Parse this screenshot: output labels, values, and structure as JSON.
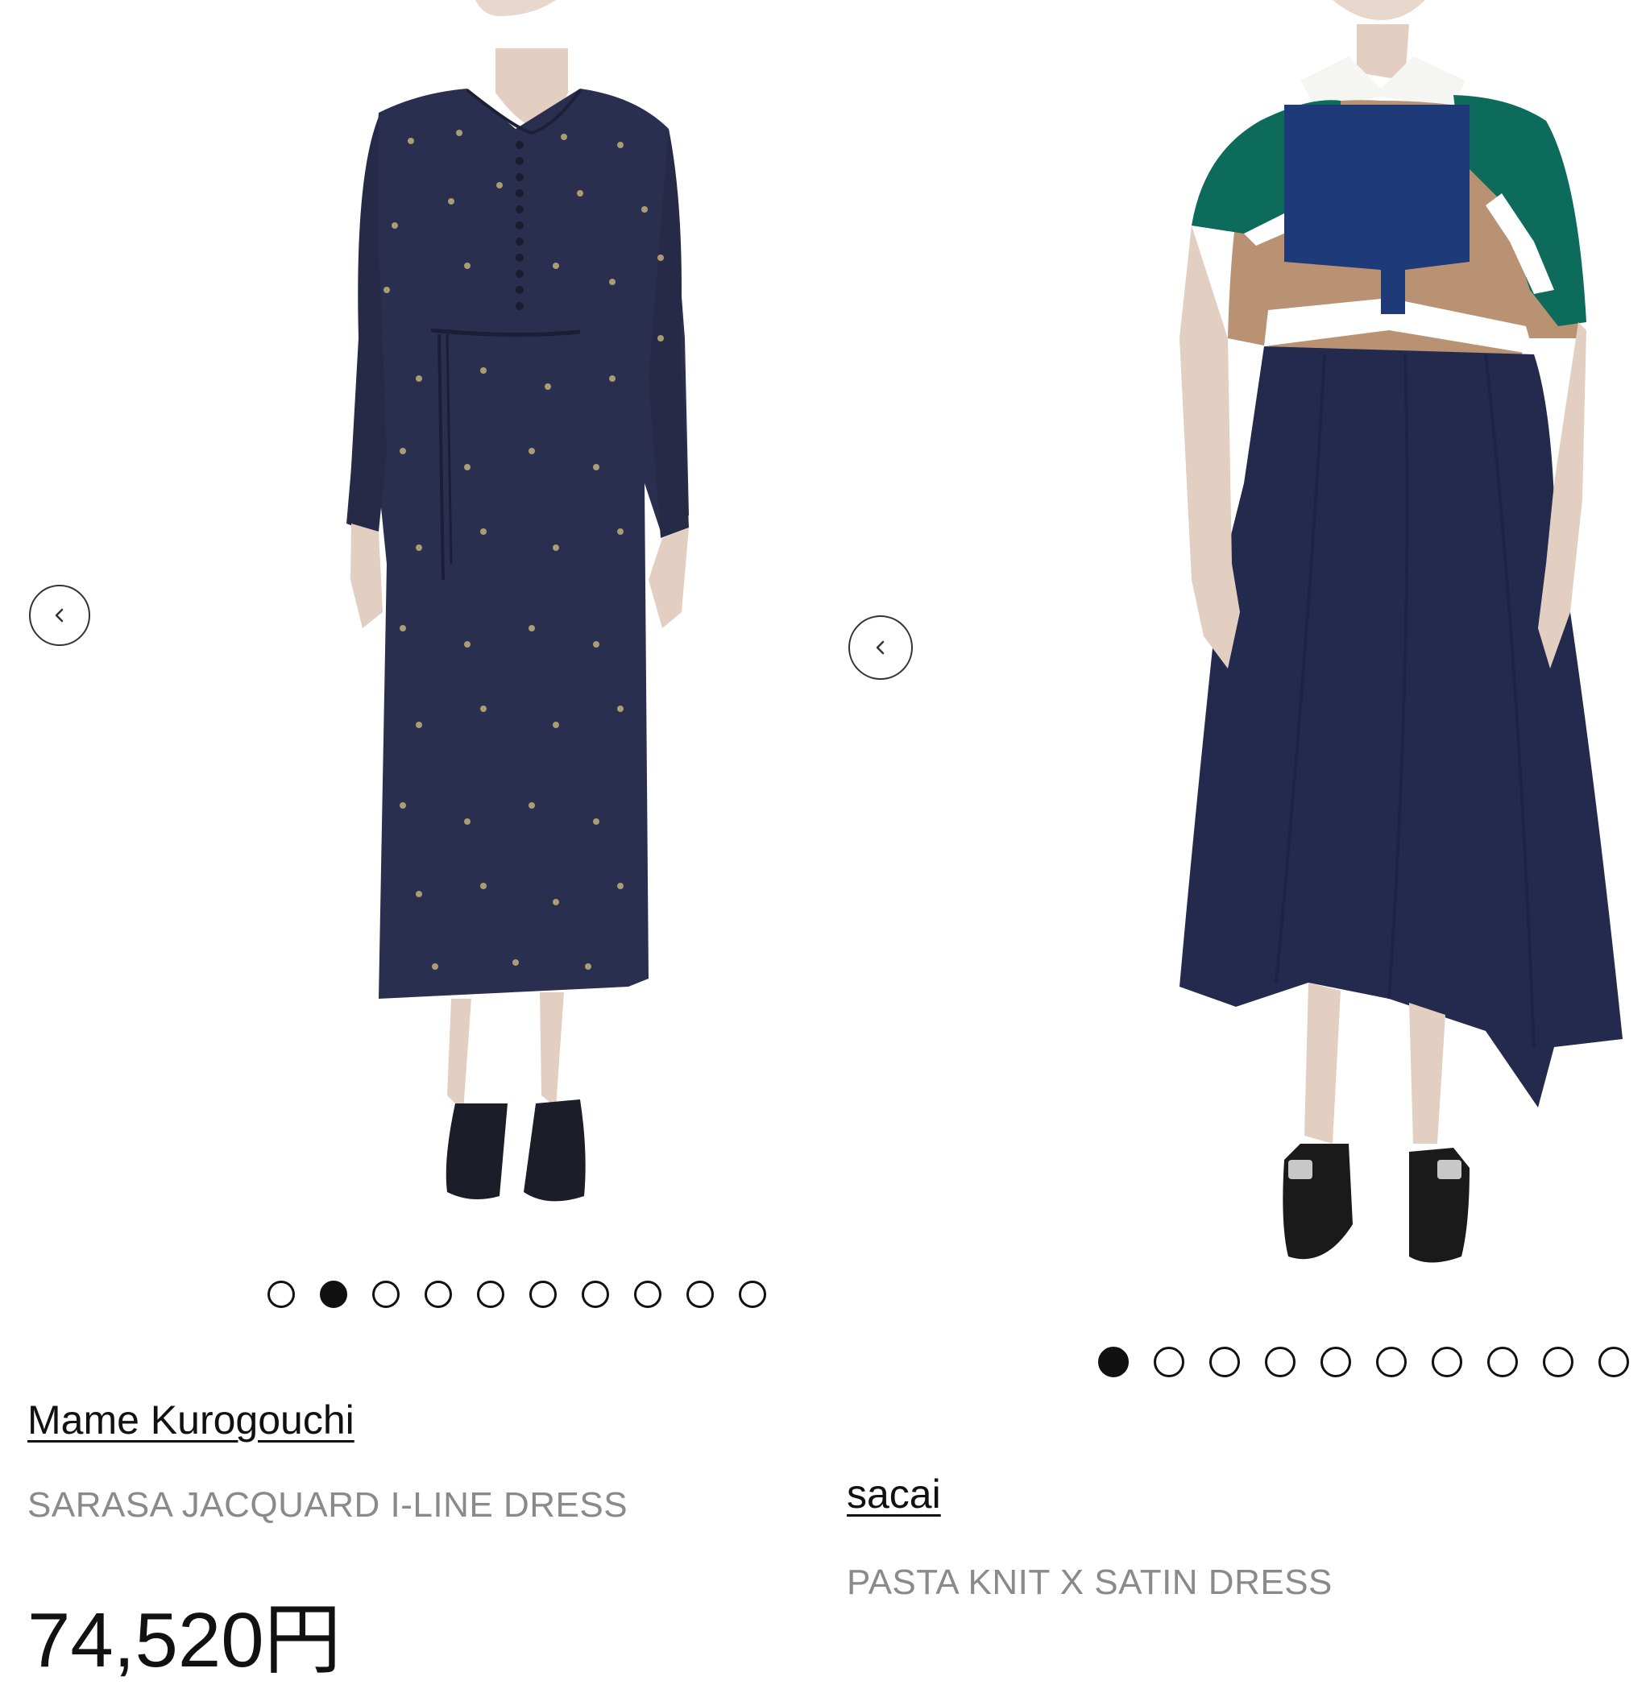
{
  "products": [
    {
      "brand": "Mame Kurogouchi",
      "name": "SARASA JACQUARD I-LINE DRESS",
      "price": "74,520円",
      "image_alt": "Navy long-sleeve dress with dotted jacquard pattern",
      "carousel": {
        "total": 10,
        "active_index": 1
      },
      "colors": {
        "dress": "#2b2f4f",
        "shoes": "#1b1d28"
      }
    },
    {
      "brand": "sacai",
      "name": "PASTA KNIT X SATIN DRESS",
      "image_alt": "Navy satin dress with green, tan and white knit top and asymmetric hem",
      "carousel": {
        "total": 10,
        "active_index": 0
      },
      "colors": {
        "dress": "#232a4e",
        "knit_green": "#0c6b5a",
        "knit_tan": "#b89273",
        "bib": "#1f3a78"
      }
    }
  ],
  "icons": {
    "prev": "chevron-left-icon"
  },
  "accent": "#111111"
}
